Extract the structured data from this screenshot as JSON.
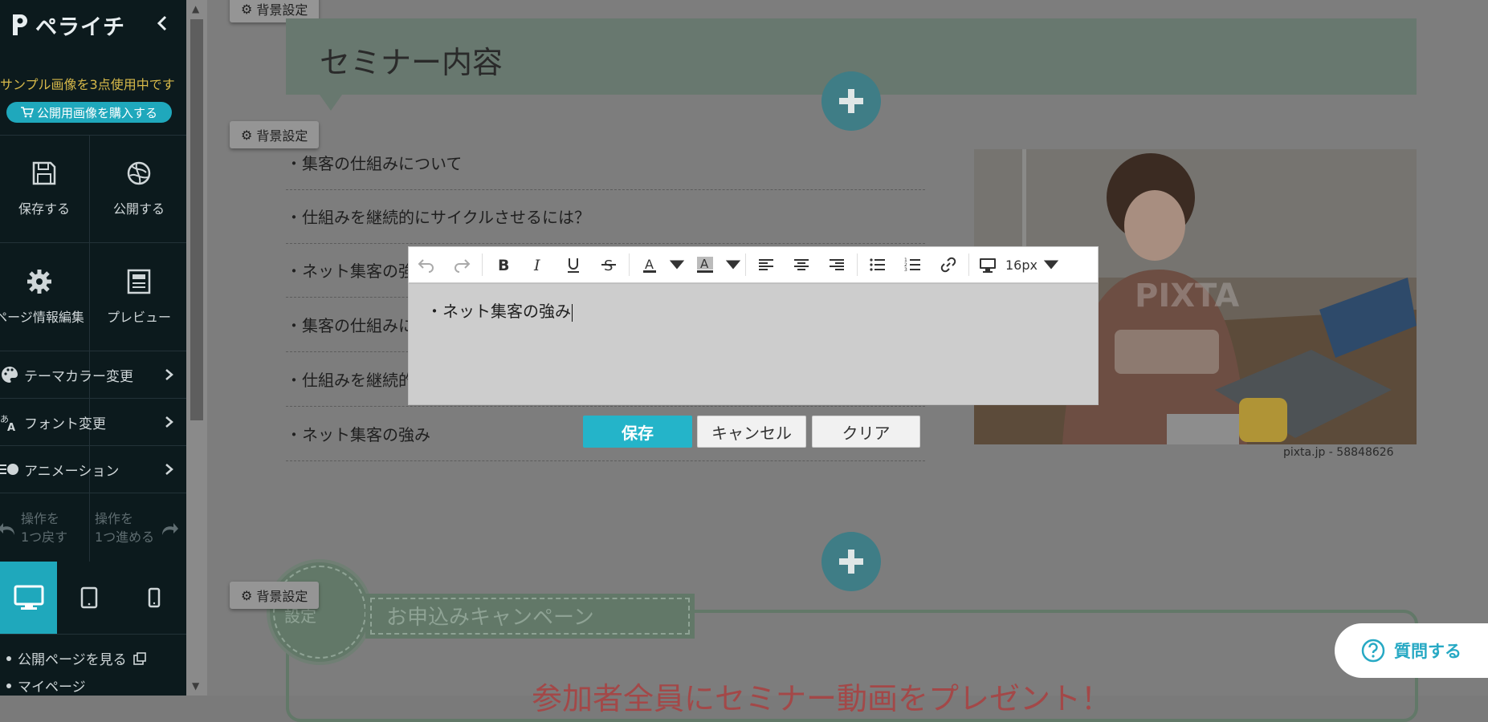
{
  "app": {
    "logo_text": "ペライチ",
    "notice": "サンプル画像を3点使用中です",
    "buy_label": "公開用画像を購入する"
  },
  "sidebar": {
    "save_label": "保存する",
    "publish_label": "公開する",
    "page_info_label": "ページ情報編集",
    "preview_label": "プレビュー",
    "menu": [
      {
        "label": "テーマカラー変更",
        "icon": "palette-icon"
      },
      {
        "label": "フォント変更",
        "icon": "font-icon"
      },
      {
        "label": "アニメーション",
        "icon": "animation-icon"
      }
    ],
    "undo_line1": "操作を",
    "undo_line2": "1つ戻す",
    "redo_line1": "操作を",
    "redo_line2": "1つ進める",
    "devices": [
      "desktop",
      "tablet",
      "mobile"
    ],
    "active_device": "desktop",
    "public_page_link": "公開ページを見る",
    "mypage_link": "マイページ"
  },
  "canvas": {
    "bg_setting_label": "背景設定",
    "section_title": "セミナー内容",
    "list_items": [
      "・集客の仕組みについて",
      "・仕組みを継続的にサイクルさせるには？",
      "・ネット集客の強み",
      "・集客の仕組みについて",
      "・仕組みを継続的にサイクルさせるには？",
      "・ネット集客の強み"
    ],
    "photo_watermark": "PIXTA",
    "photo_caption": "pixta.jp - 58848626",
    "campaign_badge": "設定",
    "campaign_ribbon": "お申込みキャンペーン",
    "campaign_headline": "参加者全員にセミナー動画をプレゼント！"
  },
  "editor": {
    "font_size": "16px",
    "content": "・ネット集客の強み",
    "save_label": "保存",
    "cancel_label": "キャンセル",
    "clear_label": "クリア"
  },
  "help": {
    "question_label": "質問する"
  },
  "colors": {
    "accent": "#1fa8bc",
    "sidebar_bg": "#0c1a1d",
    "notice": "#d7b94a",
    "help_text": "#27a9c4"
  }
}
